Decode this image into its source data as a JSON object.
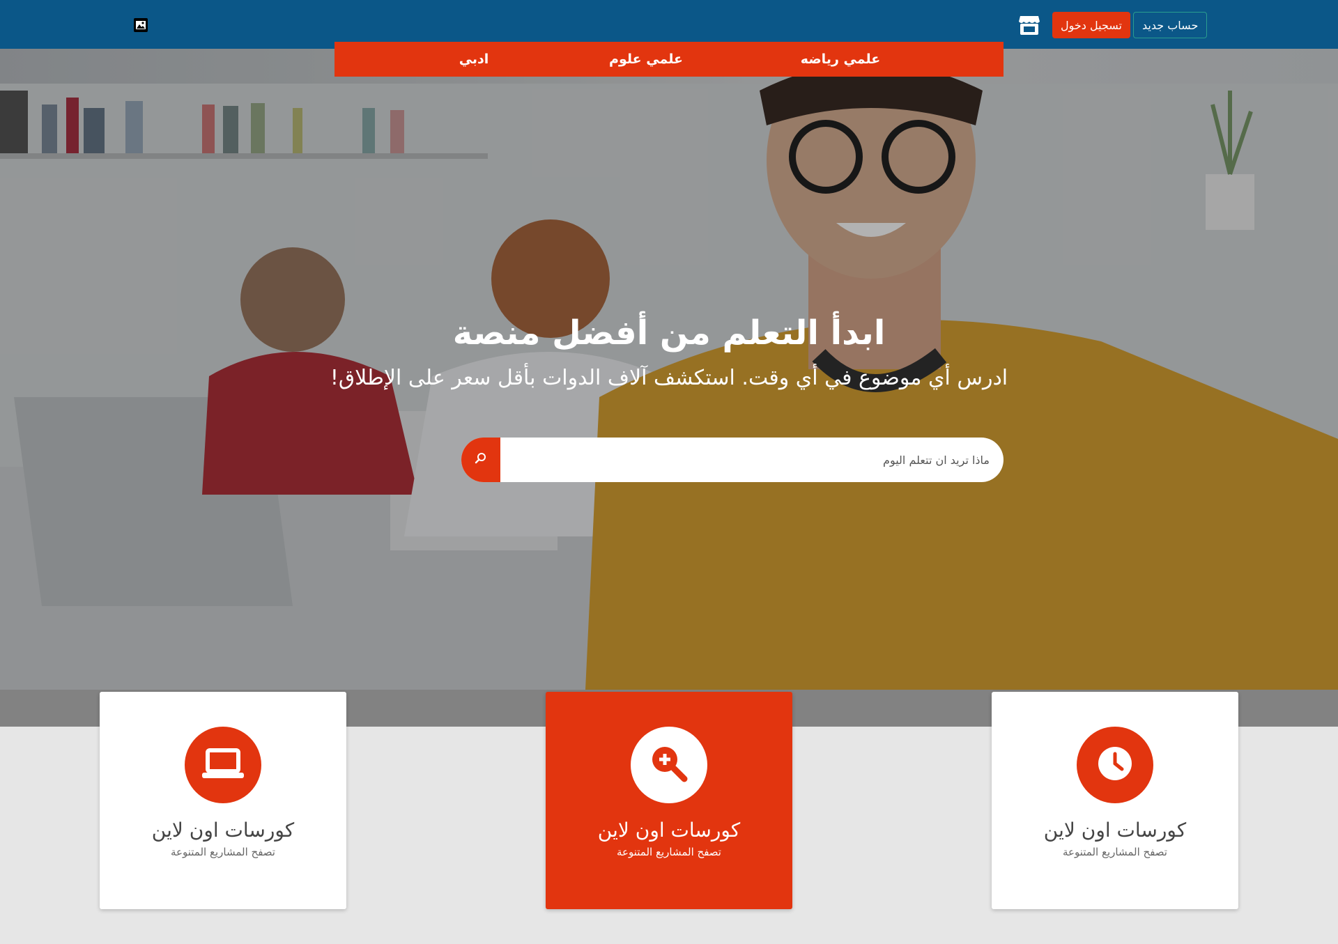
{
  "header": {
    "logo_icon": "image-icon",
    "store_icon": "store-icon",
    "login_label": "تسجيل دخول",
    "register_label": "حساب جديد"
  },
  "categories": [
    {
      "label": "علمي رياضه"
    },
    {
      "label": "علمي علوم"
    },
    {
      "label": "ادبي"
    }
  ],
  "hero": {
    "title": "ابدأ التعلم من أفضل منصة",
    "subtitle": "!ادرس أي موضوع في أي وقت. استكشف آلاف الدوات بأقل سعر على الإطلاق",
    "search_placeholder": "ماذا تريد ان تتعلم اليوم",
    "search_icon": "search-icon"
  },
  "features": [
    {
      "title": "كورسات اون لاين",
      "desc": "تصفح المشاريع المتنوعة",
      "icon": "laptop-icon",
      "active": false
    },
    {
      "title": "كورسات اون لاين",
      "desc": "تصفح المشاريع المتنوعة",
      "icon": "zoom-in-icon",
      "active": true
    },
    {
      "title": "كورسات اون لاين",
      "desc": "تصفح المشاريع المتنوعة",
      "icon": "clock-icon",
      "active": false
    }
  ],
  "colors": {
    "topbar": "#0b5788",
    "accent": "#e2350f",
    "page_bg": "#e6e6e6"
  }
}
